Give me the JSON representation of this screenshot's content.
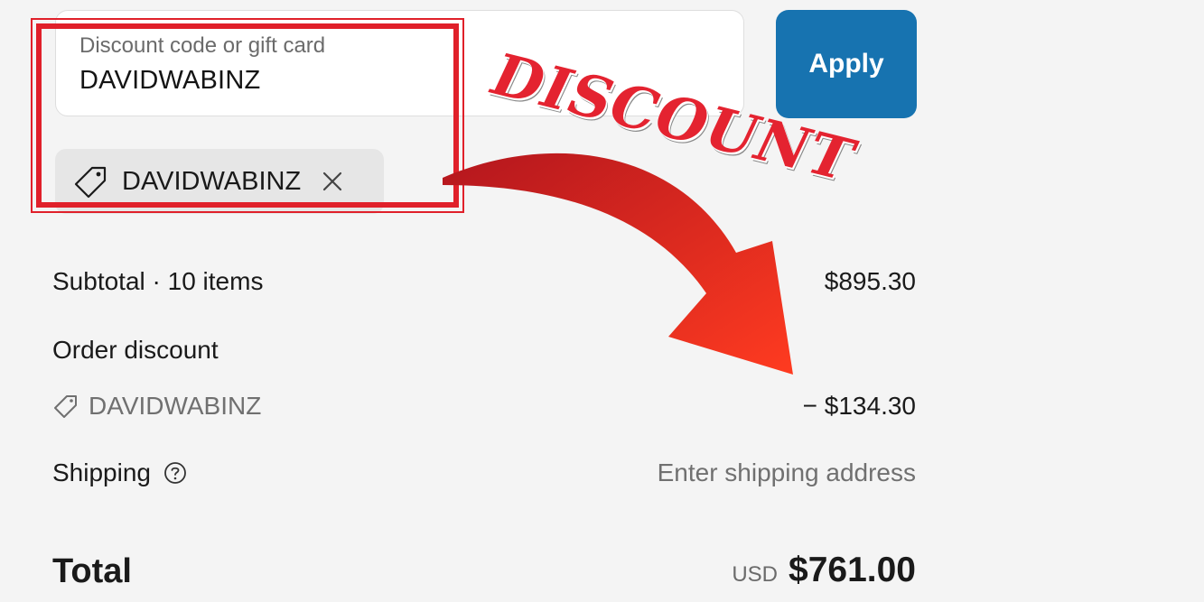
{
  "discount_field": {
    "label": "Discount code or gift card",
    "value": "DAVIDWABINZ"
  },
  "apply_button": {
    "label": "Apply"
  },
  "applied_code_chip": {
    "code": "DAVIDWABINZ",
    "tag_icon": "tag-icon",
    "remove_icon": "close-icon"
  },
  "annotation": {
    "stamp_text": "DISCOUNT",
    "color": "#e42330"
  },
  "summary": {
    "subtotal_label": "Subtotal · 10 items",
    "subtotal_value": "$895.30",
    "order_discount_label": "Order discount",
    "discount_code": "DAVIDWABINZ",
    "discount_value": "− $134.30",
    "shipping_label": "Shipping",
    "shipping_value": "Enter shipping address",
    "total_label": "Total",
    "currency": "USD",
    "total_value": "$761.00"
  },
  "colors": {
    "accent": "#1773b0",
    "background": "#f4f4f4"
  }
}
